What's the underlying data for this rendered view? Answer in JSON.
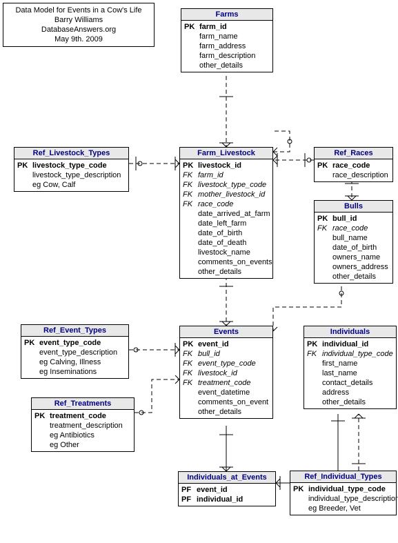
{
  "meta": {
    "title": "Data Model for Events in a Cow's Life",
    "author": "Barry Williams",
    "site": "DatabaseAnswers.org",
    "date": "May 9th. 2009"
  },
  "entities": {
    "farms": {
      "title": "Farms",
      "pk": "farm_id",
      "attrs": [
        "farm_name",
        "farm_address",
        "farm_description",
        "other_details"
      ]
    },
    "ref_livestock_types": {
      "title": "Ref_Livestock_Types",
      "pk": "livestock_type_code",
      "attrs": [
        "livestock_type_description",
        "eg Cow, Calf"
      ]
    },
    "farm_livestock": {
      "title": "Farm_Livestock",
      "pk": "livestock_id",
      "fks": [
        "farm_id",
        "livestock_type_code",
        "mother_livestock_id",
        "race_code"
      ],
      "attrs": [
        "date_arrived_at_farm",
        "date_left_farm",
        "date_of_birth",
        "date_of_death",
        "livestock_name",
        "comments_on_events",
        "other_details"
      ]
    },
    "ref_races": {
      "title": "Ref_Races",
      "pk": "race_code",
      "attrs": [
        "race_description"
      ]
    },
    "bulls": {
      "title": "Bulls",
      "pk": "bull_id",
      "fks": [
        "race_code"
      ],
      "attrs": [
        "bull_name",
        "date_of_birth",
        "owners_name",
        "owners_address",
        "other_details"
      ]
    },
    "ref_event_types": {
      "title": "Ref_Event_Types",
      "pk": "event_type_code",
      "attrs": [
        "event_type_description",
        "eg Calving, Illness",
        "eg Inseminations"
      ]
    },
    "events": {
      "title": "Events",
      "pk": "event_id",
      "fks": [
        "bull_id",
        "event_type_code",
        "livestock_id",
        "treatment_code"
      ],
      "attrs": [
        "event_datetime",
        "comments_on_event",
        "other_details"
      ]
    },
    "individuals": {
      "title": "Individuals",
      "pk": "individual_id",
      "fks": [
        "individual_type_code"
      ],
      "attrs": [
        "first_name",
        "last_name",
        "contact_details",
        "address",
        "other_details"
      ]
    },
    "ref_treatments": {
      "title": "Ref_Treatments",
      "pk": "treatment_code",
      "attrs": [
        "treatment_description",
        "eg Antibiotics",
        "eg Other"
      ]
    },
    "individuals_at_events": {
      "title": "Individuals_at_Events",
      "pfs": [
        "event_id",
        "individual_id"
      ]
    },
    "ref_individual_types": {
      "title": "Ref_Individual_Types",
      "pk": "individual_type_code",
      "attrs": [
        "individual_type_description",
        "eg Breeder, Vet"
      ]
    }
  },
  "chart_data": {
    "type": "er-diagram",
    "entities": [
      {
        "name": "Farms",
        "pk": [
          "farm_id"
        ]
      },
      {
        "name": "Ref_Livestock_Types",
        "pk": [
          "livestock_type_code"
        ]
      },
      {
        "name": "Farm_Livestock",
        "pk": [
          "livestock_id"
        ],
        "fk": [
          "farm_id",
          "livestock_type_code",
          "mother_livestock_id",
          "race_code"
        ]
      },
      {
        "name": "Ref_Races",
        "pk": [
          "race_code"
        ]
      },
      {
        "name": "Bulls",
        "pk": [
          "bull_id"
        ],
        "fk": [
          "race_code"
        ]
      },
      {
        "name": "Ref_Event_Types",
        "pk": [
          "event_type_code"
        ]
      },
      {
        "name": "Events",
        "pk": [
          "event_id"
        ],
        "fk": [
          "bull_id",
          "event_type_code",
          "livestock_id",
          "treatment_code"
        ]
      },
      {
        "name": "Individuals",
        "pk": [
          "individual_id"
        ],
        "fk": [
          "individual_type_code"
        ]
      },
      {
        "name": "Ref_Treatments",
        "pk": [
          "treatment_code"
        ]
      },
      {
        "name": "Individuals_at_Events",
        "pk": [
          "event_id",
          "individual_id"
        ]
      },
      {
        "name": "Ref_Individual_Types",
        "pk": [
          "individual_type_code"
        ]
      }
    ],
    "relationships": [
      {
        "from": "Farms",
        "to": "Farm_Livestock",
        "type": "1:N"
      },
      {
        "from": "Ref_Livestock_Types",
        "to": "Farm_Livestock",
        "type": "1:N"
      },
      {
        "from": "Farm_Livestock",
        "to": "Farm_Livestock",
        "type": "1:N",
        "note": "mother_livestock_id self-reference"
      },
      {
        "from": "Ref_Races",
        "to": "Farm_Livestock",
        "type": "1:N"
      },
      {
        "from": "Ref_Races",
        "to": "Bulls",
        "type": "1:N"
      },
      {
        "from": "Farm_Livestock",
        "to": "Events",
        "type": "1:N"
      },
      {
        "from": "Bulls",
        "to": "Events",
        "type": "1:N"
      },
      {
        "from": "Ref_Event_Types",
        "to": "Events",
        "type": "1:N"
      },
      {
        "from": "Ref_Treatments",
        "to": "Events",
        "type": "1:N"
      },
      {
        "from": "Events",
        "to": "Individuals_at_Events",
        "type": "1:N"
      },
      {
        "from": "Individuals",
        "to": "Individuals_at_Events",
        "type": "1:N"
      },
      {
        "from": "Ref_Individual_Types",
        "to": "Individuals",
        "type": "1:N"
      }
    ]
  }
}
